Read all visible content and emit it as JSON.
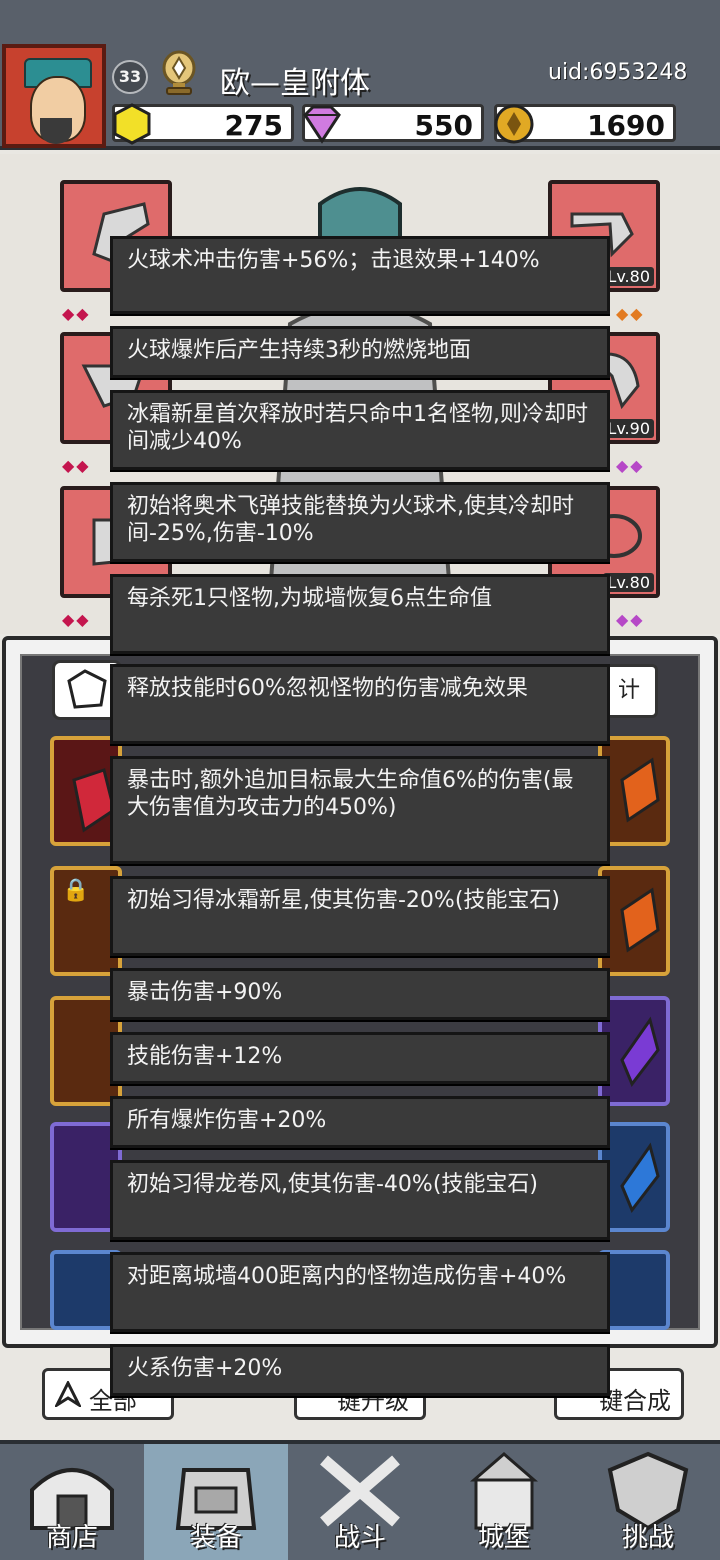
{
  "player": {
    "level": "33",
    "name": "欧—皇附体",
    "uid": "uid:6953248"
  },
  "resources": {
    "gold_gem": "275",
    "purple_gem": "550",
    "coin": "1690"
  },
  "equipment": {
    "slot_levels": [
      "Lv.80",
      "Lv.90",
      "Lv.80"
    ]
  },
  "panel": {
    "stat_tab_label": "计"
  },
  "tooltips": [
    "火球术冲击伤害+56%；击退效果+140%",
    "火球爆炸后产生持续3秒的燃烧地面",
    "冰霜新星首次释放时若只命中1名怪物,则冷却时间减少40%",
    "初始将奥术飞弹技能替换为火球术,使其冷却时间-25%,伤害-10%",
    "每杀死1只怪物,为城墙恢复6点生命值",
    "释放技能时60%忽视怪物的伤害减免效果",
    "暴击时,额外追加目标最大生命值6%的伤害(最大伤害值为攻击力的450%)",
    "初始习得冰霜新星,使其伤害-20%(技能宝石)",
    "暴击伤害+90%",
    "技能伤害+12%",
    "所有爆炸伤害+20%",
    "初始习得龙卷风,使其伤害-40%(技能宝石)",
    "对距离城墙400距离内的怪物造成伤害+40%",
    "火系伤害+20%"
  ],
  "buttons": {
    "all_label": "全部",
    "upgrade_label": "键升级",
    "merge_label": "键合成"
  },
  "nav": [
    {
      "label": "商店"
    },
    {
      "label": "装备"
    },
    {
      "label": "战斗"
    },
    {
      "label": "城堡"
    },
    {
      "label": "挑战"
    }
  ],
  "colors": {
    "tooltip_bg": "#3a3a3a",
    "slot_red": "#df6b6b",
    "nav_bg": "#5b6470",
    "nav_active": "#8ba6b8"
  }
}
